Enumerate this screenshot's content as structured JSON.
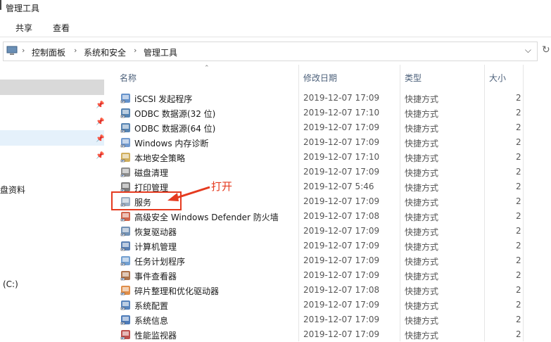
{
  "window": {
    "title": "管理工具"
  },
  "ribbon": {
    "tabs": [
      "共享",
      "查看"
    ]
  },
  "address": {
    "crumbs": [
      "控制面板",
      "系统和安全",
      "管理工具"
    ]
  },
  "nav": {
    "items": [
      {
        "label": "盘资料"
      },
      {
        "label": "(C:)"
      }
    ]
  },
  "columns": {
    "name": "名称",
    "date": "修改日期",
    "type": "类型",
    "size": "大小"
  },
  "files": [
    {
      "name": "iSCSI 发起程序",
      "date": "2019-12-07 17:09",
      "type": "快捷方式",
      "size": "2",
      "icon": "iscsi-icon"
    },
    {
      "name": "ODBC 数据源(32 位)",
      "date": "2019-12-07 17:10",
      "type": "快捷方式",
      "size": "2",
      "icon": "odbc-icon"
    },
    {
      "name": "ODBC 数据源(64 位)",
      "date": "2019-12-07 17:09",
      "type": "快捷方式",
      "size": "2",
      "icon": "odbc-icon"
    },
    {
      "name": "Windows 内存诊断",
      "date": "2019-12-07 17:09",
      "type": "快捷方式",
      "size": "2",
      "icon": "memory-icon"
    },
    {
      "name": "本地安全策略",
      "date": "2019-12-07 17:10",
      "type": "快捷方式",
      "size": "2",
      "icon": "security-policy-icon"
    },
    {
      "name": "磁盘清理",
      "date": "2019-12-07 17:09",
      "type": "快捷方式",
      "size": "2",
      "icon": "disk-cleanup-icon"
    },
    {
      "name": "打印管理",
      "date": "2019-12-07 5:46",
      "type": "快捷方式",
      "size": "2",
      "icon": "printer-icon"
    },
    {
      "name": "服务",
      "date": "2019-12-07 17:09",
      "type": "快捷方式",
      "size": "2",
      "icon": "services-icon"
    },
    {
      "name": "高级安全 Windows Defender 防火墙",
      "date": "2019-12-07 17:08",
      "type": "快捷方式",
      "size": "2",
      "icon": "firewall-icon"
    },
    {
      "name": "恢复驱动器",
      "date": "2019-12-07 17:09",
      "type": "快捷方式",
      "size": "2",
      "icon": "recovery-drive-icon"
    },
    {
      "name": "计算机管理",
      "date": "2019-12-07 17:09",
      "type": "快捷方式",
      "size": "2",
      "icon": "computer-management-icon"
    },
    {
      "name": "任务计划程序",
      "date": "2019-12-07 17:09",
      "type": "快捷方式",
      "size": "2",
      "icon": "task-scheduler-icon"
    },
    {
      "name": "事件查看器",
      "date": "2019-12-07 17:09",
      "type": "快捷方式",
      "size": "2",
      "icon": "event-viewer-icon"
    },
    {
      "name": "碎片整理和优化驱动器",
      "date": "2019-12-07 17:08",
      "type": "快捷方式",
      "size": "2",
      "icon": "defrag-icon"
    },
    {
      "name": "系统配置",
      "date": "2019-12-07 17:09",
      "type": "快捷方式",
      "size": "2",
      "icon": "system-config-icon"
    },
    {
      "name": "系统信息",
      "date": "2019-12-07 17:09",
      "type": "快捷方式",
      "size": "2",
      "icon": "system-info-icon"
    },
    {
      "name": "性能监视器",
      "date": "2019-12-07 17:09",
      "type": "快捷方式",
      "size": "2",
      "icon": "performance-monitor-icon"
    }
  ],
  "annotation": {
    "text": "打开"
  },
  "colors": {
    "accent": "#e53a1f"
  }
}
